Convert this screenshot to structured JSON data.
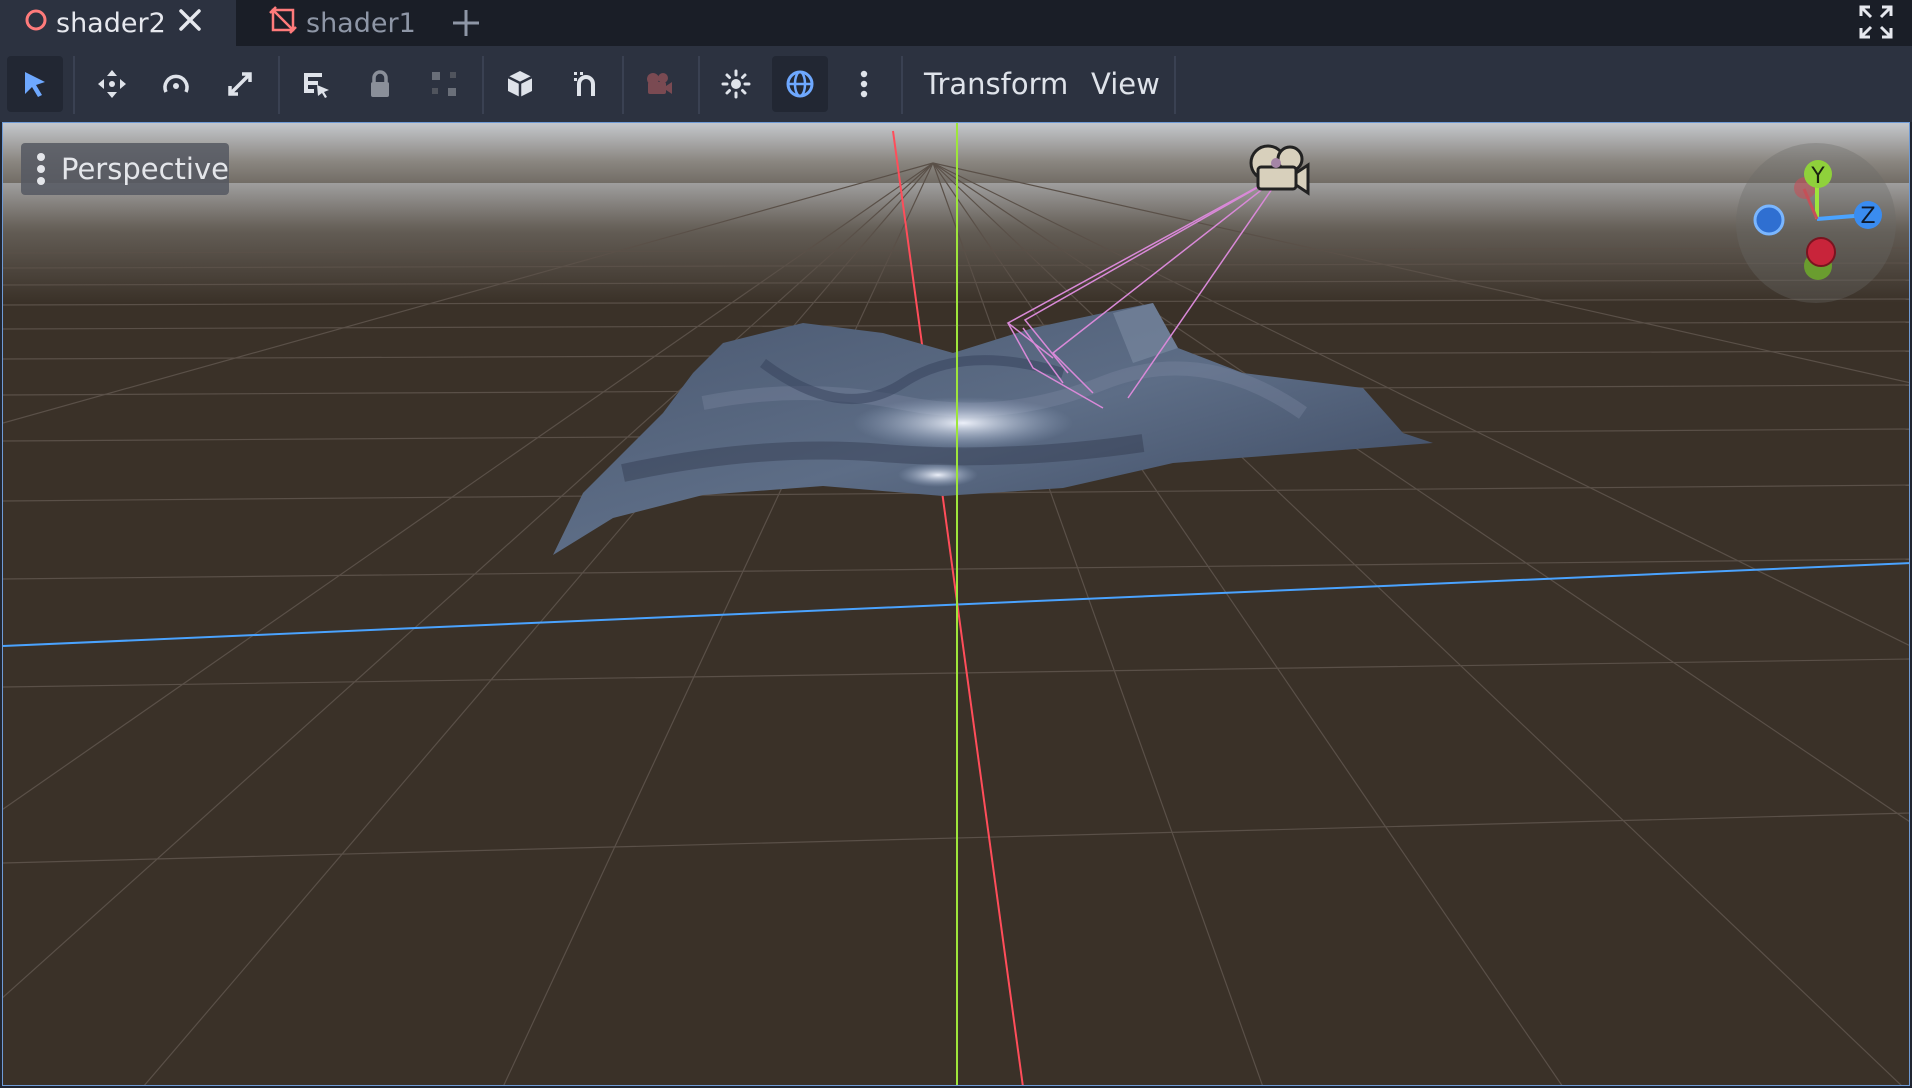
{
  "tabs": [
    {
      "label": "shader2",
      "active": true,
      "icon": "ring-icon"
    },
    {
      "label": "shader1",
      "active": false,
      "icon": "node3d-icon"
    }
  ],
  "toolbar": {
    "tools": [
      "select-tool",
      "move-tool",
      "rotate-tool",
      "scale-tool",
      "list-select-tool",
      "lock-tool",
      "group-tool",
      "local-space-tool",
      "snap-tool",
      "camera-preview-tool",
      "sun-toggle",
      "environment-toggle",
      "more-options"
    ],
    "transform_label": "Transform",
    "view_label": "View"
  },
  "viewport": {
    "view_mode_label": "Perspective",
    "gizmo_axes": {
      "y": "Y",
      "z": "Z"
    },
    "colors": {
      "x_axis": "#ff4d5a",
      "y_axis": "#9ee53b",
      "z_axis": "#4aa3ff",
      "ground": "#3a3128"
    }
  }
}
